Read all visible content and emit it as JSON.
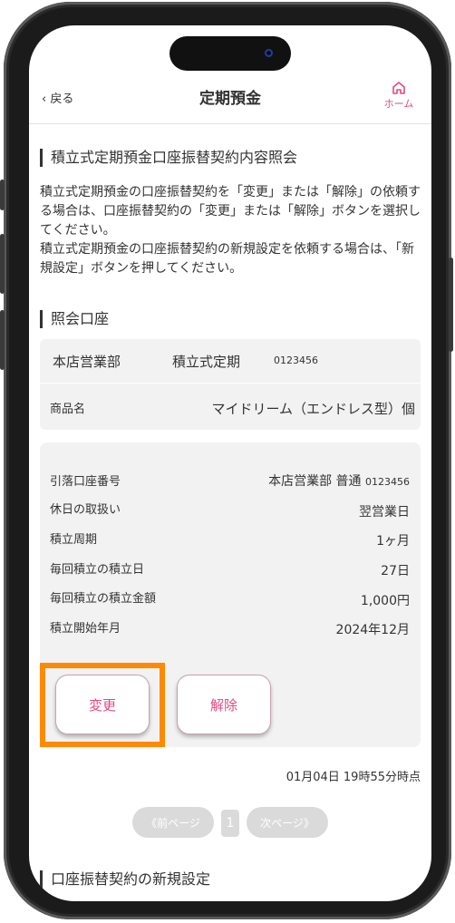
{
  "header": {
    "back_label": "‹ 戻る",
    "title": "定期預金",
    "home_label": "ホーム"
  },
  "section1": {
    "heading": "積立式定期預金口座振替契約内容照会",
    "para1": "積立式定期預金の口座振替契約を「変更」または「解除」の依頼する場合は、口座振替契約の「変更」または「解除」ボタンを選択してください。",
    "para2": "積立式定期預金の口座振替契約の新規設定を依頼する場合は、「新規設定」ボタンを押してください。"
  },
  "inquiry": {
    "heading": "照会口座",
    "branch": "本店営業部",
    "account_type": "積立式定期",
    "account_number": "0123456",
    "product_label": "商品名",
    "product_value": "マイドリーム（エンドレス型）個"
  },
  "details": {
    "rows": [
      {
        "label": "引落口座番号",
        "value": "本店営業部 普通",
        "value_small": "0123456"
      },
      {
        "label": "休日の取扱い",
        "value": "翌営業日"
      },
      {
        "label": "積立周期",
        "value": "1ヶ月"
      },
      {
        "label": "毎回積立の積立日",
        "value": "27日"
      },
      {
        "label": "毎回積立の積立金額",
        "value": "1,000円"
      },
      {
        "label": "積立開始年月",
        "value": "2024年12月"
      }
    ],
    "change_label": "変更",
    "cancel_label": "解除"
  },
  "timestamp": "01月04日 19時55分時点",
  "pager": {
    "prev_label": "《前ページ",
    "page": "1",
    "next_label": "次ページ》"
  },
  "section2": {
    "heading": "口座振替契約の新規設定"
  },
  "colors": {
    "accent": "#e04a83",
    "highlight": "#ff8a00",
    "panel": "#f2f2f2"
  }
}
